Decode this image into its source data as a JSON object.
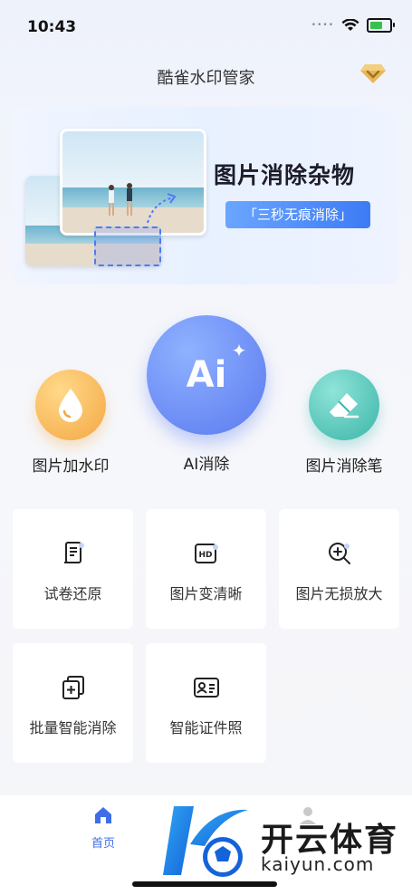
{
  "status_bar": {
    "time": "10:43"
  },
  "header": {
    "title": "酷雀水印管家"
  },
  "banner": {
    "title": "图片消除杂物",
    "tag": "「三秒无痕消除」"
  },
  "main_tools": [
    {
      "label": "图片加水印",
      "icon": "water-drop-icon",
      "color": "#f4a742"
    },
    {
      "label": "AI消除",
      "icon_text": "Ai",
      "color": "#5a79ef"
    },
    {
      "label": "图片消除笔",
      "icon": "eraser-icon",
      "color": "#3bb5a8"
    }
  ],
  "tool_cards": [
    {
      "label": "试卷还原",
      "icon": "document-icon"
    },
    {
      "label": "图片变清晰",
      "icon": "hd-icon"
    },
    {
      "label": "图片无损放大",
      "icon": "zoom-in-icon"
    },
    {
      "label": "批量智能消除",
      "icon": "batch-add-icon"
    },
    {
      "label": "智能证件照",
      "icon": "id-card-icon"
    }
  ],
  "tab_bar": {
    "home": "首页",
    "home_color": "#3f6ee8"
  },
  "watermark": {
    "cn": "开云体育",
    "en": "kaiyun.com"
  }
}
